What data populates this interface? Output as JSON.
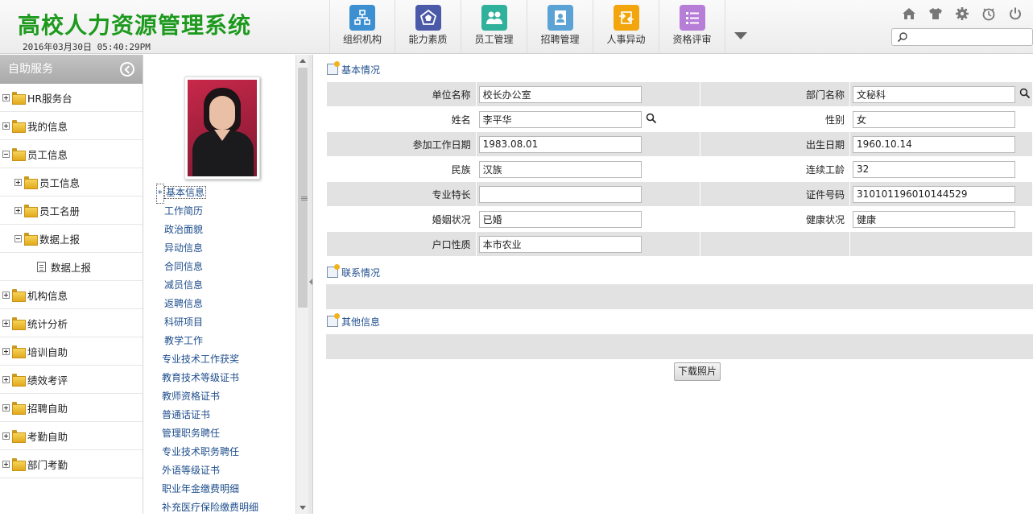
{
  "app": {
    "title": "高校人力资源管理系统",
    "datetime": "2016年03月30日 05:40:29PM"
  },
  "nav": [
    {
      "label": "组织机构",
      "icon": "org-chart-icon",
      "color": "#3c8fd0"
    },
    {
      "label": "能力素质",
      "icon": "pentagon-icon",
      "color": "#4a5aa8"
    },
    {
      "label": "员工管理",
      "icon": "users-icon",
      "color": "#2fb19b"
    },
    {
      "label": "招聘管理",
      "icon": "id-card-icon",
      "color": "#5aa3d4"
    },
    {
      "label": "人事异动",
      "icon": "transfer-icon",
      "color": "#f2a50c"
    },
    {
      "label": "资格评审",
      "icon": "list-icon",
      "color": "#b77ed8"
    }
  ],
  "toolbar": {
    "icons": [
      "home-icon",
      "shirt-icon",
      "gear-icon",
      "clock-icon",
      "power-icon"
    ],
    "search_value": ""
  },
  "sidebar": {
    "title": "自助服务",
    "items": [
      {
        "label": "HR服务台",
        "level": 0,
        "state": "plus"
      },
      {
        "label": "我的信息",
        "level": 0,
        "state": "plus"
      },
      {
        "label": "员工信息",
        "level": 0,
        "state": "minus"
      },
      {
        "label": "员工信息",
        "level": 1,
        "state": "plus"
      },
      {
        "label": "员工名册",
        "level": 1,
        "state": "plus"
      },
      {
        "label": "数据上报",
        "level": 1,
        "state": "minus"
      },
      {
        "label": "数据上报",
        "level": 2,
        "state": "leaf"
      },
      {
        "label": "机构信息",
        "level": 0,
        "state": "plus"
      },
      {
        "label": "统计分析",
        "level": 0,
        "state": "plus"
      },
      {
        "label": "培训自助",
        "level": 0,
        "state": "plus"
      },
      {
        "label": "绩效考评",
        "level": 0,
        "state": "plus"
      },
      {
        "label": "招聘自助",
        "level": 0,
        "state": "plus"
      },
      {
        "label": "考勤自助",
        "level": 0,
        "state": "plus"
      },
      {
        "label": "部门考勤",
        "level": 0,
        "state": "plus"
      }
    ]
  },
  "info_menu": {
    "active_marker": "*",
    "items": [
      "基本信息",
      "工作简历",
      "政治面貌",
      "异动信息",
      "合同信息",
      "减员信息",
      "返聘信息",
      "科研项目",
      "教学工作",
      "专业技术工作获奖",
      "教育技术等级证书",
      "教师资格证书",
      "普通话证书",
      "管理职务聘任",
      "专业技术职务聘任",
      "外语等级证书",
      "职业年金缴费明细",
      "补充医疗保险缴费明细"
    ]
  },
  "sections": {
    "basic": "基本情况",
    "contact": "联系情况",
    "other": "其他信息"
  },
  "form": {
    "rows": [
      [
        {
          "label": "单位名称",
          "value": "校长办公室"
        },
        {
          "label": "部门名称",
          "value": "文秘科",
          "search": true
        }
      ],
      [
        {
          "label": "姓名",
          "value": "李平华",
          "search": true
        },
        {
          "label": "性别",
          "value": "女"
        }
      ],
      [
        {
          "label": "参加工作日期",
          "value": "1983.08.01"
        },
        {
          "label": "出生日期",
          "value": "1960.10.14"
        }
      ],
      [
        {
          "label": "民族",
          "value": "汉族"
        },
        {
          "label": "连续工龄",
          "value": "32"
        }
      ],
      [
        {
          "label": "专业特长",
          "value": ""
        },
        {
          "label": "证件号码",
          "value": "310101196010144529"
        }
      ],
      [
        {
          "label": "婚姻状况",
          "value": "已婚"
        },
        {
          "label": "健康状况",
          "value": "健康"
        }
      ],
      [
        {
          "label": "户口性质",
          "value": "本市农业"
        },
        {
          "label": "",
          "value": null
        }
      ]
    ]
  },
  "buttons": {
    "download_photo": "下载照片"
  }
}
